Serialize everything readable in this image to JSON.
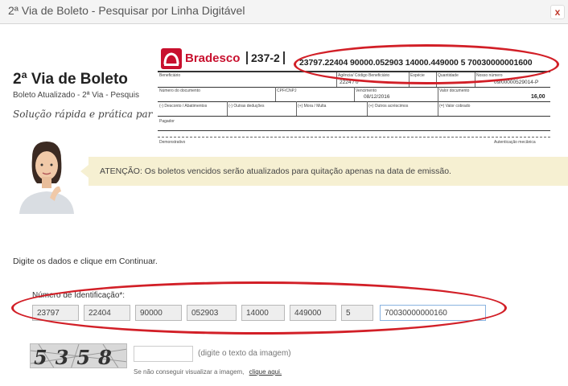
{
  "window": {
    "title": "2ª Via de Boleto - Pesquisar por Linha Digitável",
    "close_label": "x"
  },
  "header": {
    "heading": "2ª Via de Boleto",
    "subheading": "Boleto Atualizado - 2ª Via - Pesquis",
    "tagline": "Solução rápida e prática par"
  },
  "boleto": {
    "bank_name": "Bradesco",
    "bank_code": "237-2",
    "digitable_line": "23797.22404 90000.052903 14000.449000 5 70030000001600",
    "labels": {
      "beneficiario": "Beneficiário",
      "agencia": "Agência/ Código Beneficiário",
      "especie": "Espécie",
      "quantidade": "Quantidade",
      "nosso_numero": "Nosso número",
      "numero_documento": "Número do documento",
      "cpf_cnpj": "CPF/CNPJ",
      "vencimento": "Vencimento",
      "valor_documento": "Valor documento",
      "desconto": "(-) Desconto / Abatimentos",
      "outras_deducoes": "(-) Outras deduções",
      "mora_multa": "(+) Mora / Multa",
      "outros_acrescimos": "(+) Outros acréscimos",
      "valor_cobrado": "(=) Valor cobrado",
      "pagador": "Pagador",
      "demonstrativo": "Demonstrativo",
      "autenticacao": "Autenticação mecânica"
    },
    "values": {
      "agencia": "2224 / 0",
      "nosso_numero": "09/00000529014-P",
      "vencimento": "08/12/2016",
      "valor": "16,00"
    }
  },
  "notice": {
    "text": "ATENÇÃO: Os boletos vencidos serão atualizados para quitação apenas na data de emissão."
  },
  "form": {
    "instructions": "Digite os dados e clique em Continuar.",
    "id_label": "Número de Identificação*:",
    "fields": [
      "23797",
      "22404",
      "90000",
      "052903",
      "14000",
      "449000",
      "5",
      "70030000000160"
    ]
  },
  "captcha": {
    "image_text": "5358",
    "hint": "(digite o texto da imagem)",
    "help_text": "Se não conseguir visualizar a imagem,",
    "help_link": "clique aqui."
  },
  "colors": {
    "highlight_oval": "#d21f27",
    "bradesco_red": "#c8102e",
    "notice_background": "#f6f0d2"
  }
}
